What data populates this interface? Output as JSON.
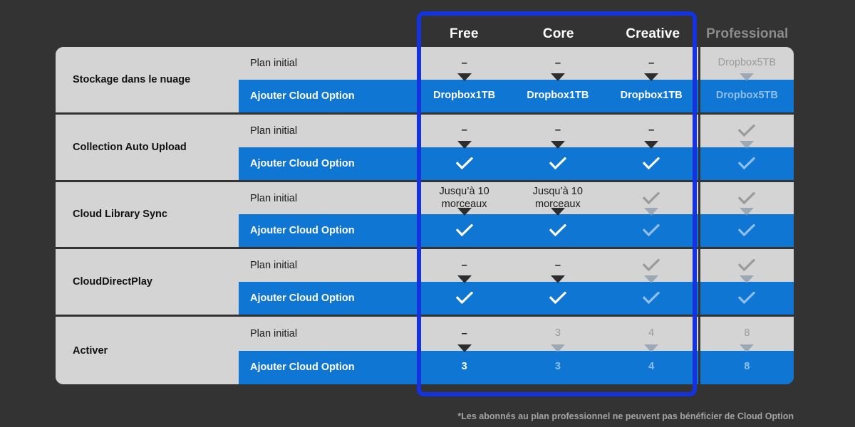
{
  "columns": [
    {
      "label": "Free",
      "dimmed": false
    },
    {
      "label": "Core",
      "dimmed": false
    },
    {
      "label": "Creative",
      "dimmed": false
    },
    {
      "label": "Professional",
      "dimmed": true
    }
  ],
  "sub_labels": {
    "initial": "Plan initial",
    "addon": "Ajouter Cloud Option"
  },
  "colors": {
    "page_background": "#333333",
    "row_background": "#d4d4d4",
    "addon_blue": "#0f76d4",
    "highlight_border": "#1432dd",
    "muted_text": "#9a9a9a",
    "addon_muted_text": "#8fbfec",
    "header_text": "#ffffff",
    "header_dim_text": "#8d8d8d",
    "footnote_text": "#a3a3a3"
  },
  "footnote": "*Les abonnés au plan professionnel ne peuvent pas bénéficier de Cloud Option",
  "rows": [
    {
      "name": "Stockage dans le nuage",
      "initial": [
        {
          "text": "–",
          "kind": "dash",
          "muted": false
        },
        {
          "text": "–",
          "kind": "dash",
          "muted": false
        },
        {
          "text": "–",
          "kind": "dash",
          "muted": false
        },
        {
          "text": "Dropbox5TB",
          "kind": "text",
          "muted": true
        }
      ],
      "addon": [
        {
          "text": "Dropbox1TB",
          "kind": "text",
          "muted": false
        },
        {
          "text": "Dropbox1TB",
          "kind": "text",
          "muted": false
        },
        {
          "text": "Dropbox1TB",
          "kind": "text",
          "muted": false
        },
        {
          "text": "Dropbox5TB",
          "kind": "text",
          "muted": true
        }
      ],
      "arrows": [
        false,
        false,
        false,
        true
      ]
    },
    {
      "name": "Collection Auto Upload",
      "initial": [
        {
          "text": "–",
          "kind": "dash",
          "muted": false
        },
        {
          "text": "–",
          "kind": "dash",
          "muted": false
        },
        {
          "text": "–",
          "kind": "dash",
          "muted": false
        },
        {
          "text": "check-icon",
          "kind": "check",
          "muted": true
        }
      ],
      "addon": [
        {
          "text": "check-icon",
          "kind": "check",
          "muted": false
        },
        {
          "text": "check-icon",
          "kind": "check",
          "muted": false
        },
        {
          "text": "check-icon",
          "kind": "check",
          "muted": false
        },
        {
          "text": "check-icon",
          "kind": "check",
          "muted": true
        }
      ],
      "arrows": [
        false,
        false,
        false,
        true
      ]
    },
    {
      "name": "Cloud Library Sync",
      "initial": [
        {
          "text": "Jusqu’à 10\nmorceaux",
          "kind": "text",
          "muted": false
        },
        {
          "text": "Jusqu’à 10\nmorceaux",
          "kind": "text",
          "muted": false
        },
        {
          "text": "check-icon",
          "kind": "check",
          "muted": true
        },
        {
          "text": "check-icon",
          "kind": "check",
          "muted": true
        }
      ],
      "addon": [
        {
          "text": "check-icon",
          "kind": "check",
          "muted": false
        },
        {
          "text": "check-icon",
          "kind": "check",
          "muted": false
        },
        {
          "text": "check-icon",
          "kind": "check",
          "muted": true
        },
        {
          "text": "check-icon",
          "kind": "check",
          "muted": true
        }
      ],
      "arrows": [
        false,
        false,
        true,
        true
      ]
    },
    {
      "name": "CloudDirectPlay",
      "initial": [
        {
          "text": "–",
          "kind": "dash",
          "muted": false
        },
        {
          "text": "–",
          "kind": "dash",
          "muted": false
        },
        {
          "text": "check-icon",
          "kind": "check",
          "muted": true
        },
        {
          "text": "check-icon",
          "kind": "check",
          "muted": true
        }
      ],
      "addon": [
        {
          "text": "check-icon",
          "kind": "check",
          "muted": false
        },
        {
          "text": "check-icon",
          "kind": "check",
          "muted": false
        },
        {
          "text": "check-icon",
          "kind": "check",
          "muted": true
        },
        {
          "text": "check-icon",
          "kind": "check",
          "muted": true
        }
      ],
      "arrows": [
        false,
        false,
        true,
        true
      ]
    },
    {
      "name": "Activer",
      "initial": [
        {
          "text": "–",
          "kind": "dash",
          "muted": false
        },
        {
          "text": "3",
          "kind": "text",
          "muted": true
        },
        {
          "text": "4",
          "kind": "text",
          "muted": true
        },
        {
          "text": "8",
          "kind": "text",
          "muted": true
        }
      ],
      "addon": [
        {
          "text": "3",
          "kind": "text",
          "muted": false
        },
        {
          "text": "3",
          "kind": "text",
          "muted": true
        },
        {
          "text": "4",
          "kind": "text",
          "muted": true
        },
        {
          "text": "8",
          "kind": "text",
          "muted": true
        }
      ],
      "arrows": [
        false,
        true,
        true,
        true
      ]
    }
  ]
}
